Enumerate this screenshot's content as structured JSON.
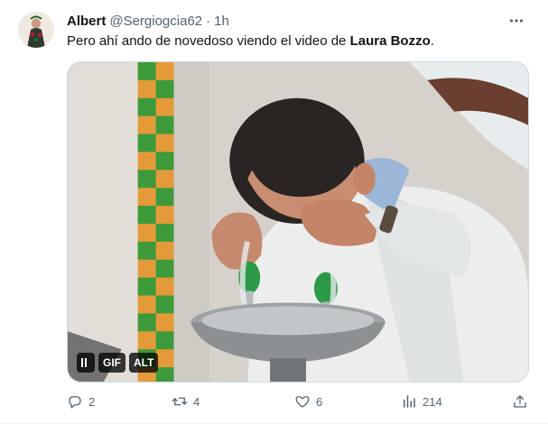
{
  "tweet": {
    "author": {
      "display_name": "Albert",
      "handle": "@Sergiogcia62",
      "separator": "·",
      "time": "1h"
    },
    "text_before": "Pero ahí ando de novedoso viendo el video de ",
    "text_bold": "Laura Bozzo",
    "text_after": ".",
    "media": {
      "pause_label": "",
      "gif_label": "GIF",
      "alt_label": "ALT"
    },
    "actions": {
      "replies": "2",
      "retweets": "4",
      "likes": "6",
      "views": "214"
    }
  },
  "colors": {
    "text_primary": "#0f1419",
    "text_secondary": "#536471",
    "border": "#cfd9de",
    "badge_bg": "#000000c4"
  },
  "icons": {
    "more": "more-horizontal-icon",
    "reply": "reply-icon",
    "retweet": "retweet-icon",
    "like": "heart-icon",
    "views": "views-chart-icon",
    "share": "share-icon",
    "pause": "pause-icon"
  }
}
